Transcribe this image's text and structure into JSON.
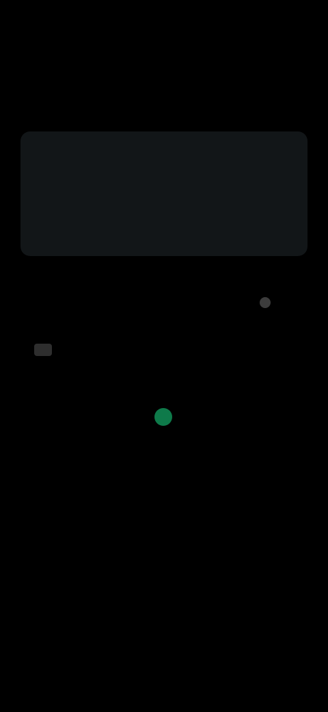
{
  "status_bar": {
    "time": "",
    "icons": [
      "",
      ""
    ]
  },
  "header": {
    "title": "",
    "subtitle": "",
    "action": ""
  },
  "card": {
    "label_left": "",
    "label_right": ""
  },
  "side_pill": {
    "label": ""
  },
  "section": {
    "title": "",
    "detail": ""
  },
  "empty_state": {
    "line1": "",
    "line2": "",
    "accent_color": "#0e7a4a"
  }
}
